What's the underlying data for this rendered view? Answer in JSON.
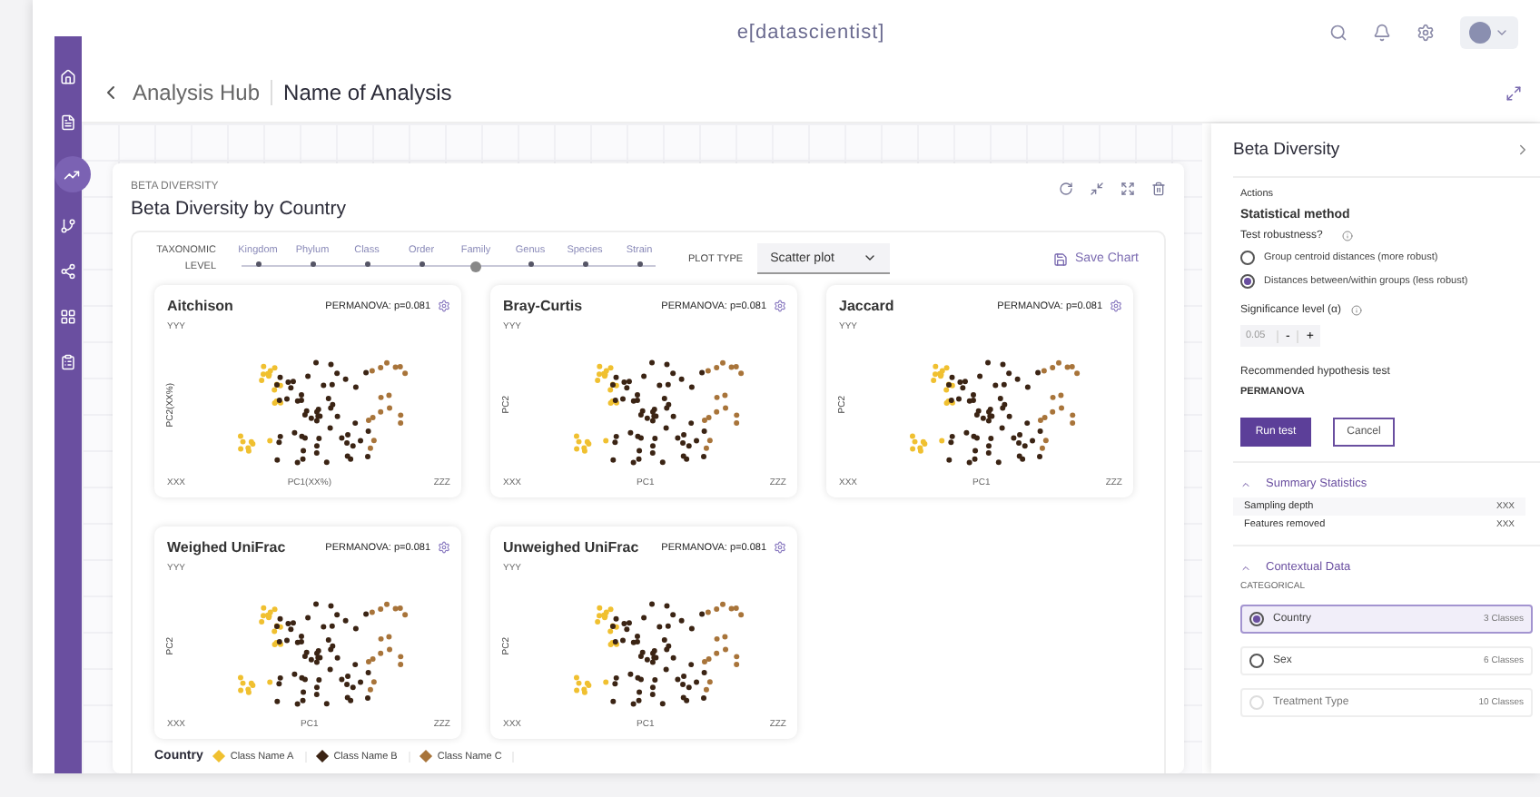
{
  "top_bar": {
    "brand": "e[datascientist]"
  },
  "sidebar": {
    "items": [
      {
        "selected": false
      },
      {
        "selected": false
      },
      {
        "selected": true
      },
      {
        "selected": false
      },
      {
        "selected": false
      },
      {
        "selected": false
      },
      {
        "selected": false
      }
    ]
  },
  "breadcrumb": {
    "parent": "Analysis Hub",
    "current": "Name of Analysis"
  },
  "analysis": {
    "eyebrow": "BETA DIVERSITY",
    "title": "Beta Diversity by Country",
    "taxonomic_level": {
      "label": "TAXONOMIC LEVEL",
      "levels": [
        {
          "label": "Kingdom",
          "selected": false
        },
        {
          "label": "Phylum",
          "selected": false
        },
        {
          "label": "Class",
          "selected": false
        },
        {
          "label": "Order",
          "selected": false
        },
        {
          "label": "Family",
          "selected": true
        },
        {
          "label": "Genus",
          "selected": false
        },
        {
          "label": "Species",
          "selected": false
        },
        {
          "label": "Strain",
          "selected": false
        }
      ]
    },
    "plot_type": {
      "label": "PLOT TYPE",
      "value": "Scatter plot"
    },
    "save_chart": "Save Chart",
    "plots": [
      {
        "title": "Aitchison",
        "stat": "PERMANOVA: p=0.081",
        "y_top": "YYY",
        "y_label": "PC2(XX%)",
        "x_left": "XXX",
        "x_label": "PC1(XX%)",
        "x_right": "ZZZ"
      },
      {
        "title": "Bray-Curtis",
        "stat": "PERMANOVA: p=0.081",
        "y_top": "YYY",
        "y_label": "PC2",
        "x_left": "XXX",
        "x_label": "PC1",
        "x_right": "ZZZ"
      },
      {
        "title": "Jaccard",
        "stat": "PERMANOVA: p=0.081",
        "y_top": "YYY",
        "y_label": "PC2",
        "x_left": "XXX",
        "x_label": "PC1",
        "x_right": "ZZZ"
      },
      {
        "title": "Weighed UniFrac",
        "stat": "PERMANOVA: p=0.081",
        "y_top": "YYY",
        "y_label": "PC2",
        "x_left": "XXX",
        "x_label": "PC1",
        "x_right": "ZZZ"
      },
      {
        "title": "Unweighed UniFrac",
        "stat": "PERMANOVA: p=0.081",
        "y_top": "YYY",
        "y_label": "PC2",
        "x_left": "XXX",
        "x_label": "PC1",
        "x_right": "ZZZ"
      }
    ],
    "legend": {
      "label": "Country",
      "classes": [
        {
          "name": "Class Name A",
          "color": "#f0c030"
        },
        {
          "name": "Class Name B",
          "color": "#3b2414"
        },
        {
          "name": "Class Name C",
          "color": "#a8743a"
        }
      ]
    }
  },
  "panel": {
    "title": "Beta Diversity",
    "actions": "Actions",
    "method_title": "Statistical method",
    "robustness_label": "Test robustness?",
    "options": [
      {
        "label": "Group centroid distances (more robust)",
        "selected": false
      },
      {
        "label": "Distances between/within groups (less robust)",
        "selected": true
      }
    ],
    "significance_label": "Significance level (α)",
    "significance": {
      "placeholder": "0.05",
      "minus": "-",
      "plus": "+"
    },
    "recommended_label": "Recommended hypothesis test",
    "recommended": "PERMANOVA",
    "run": "Run test",
    "cancel": "Cancel",
    "summary": {
      "title": "Summary Statistics",
      "expanded": true,
      "rows": [
        {
          "label": "Sampling depth",
          "value": "XXX"
        },
        {
          "label": "Features removed",
          "value": "XXX"
        }
      ]
    },
    "contextual": {
      "title": "Contextual Data",
      "expanded": true,
      "group": "CATEGORICAL",
      "variables": [
        {
          "name": "Country",
          "count": "3 Classes",
          "selected": true,
          "disabled": false
        },
        {
          "name": "Sex",
          "count": "6 Classes",
          "selected": false,
          "disabled": false
        },
        {
          "name": "Treatment Type",
          "count": "10 Classes",
          "selected": false,
          "disabled": true
        }
      ]
    }
  }
}
